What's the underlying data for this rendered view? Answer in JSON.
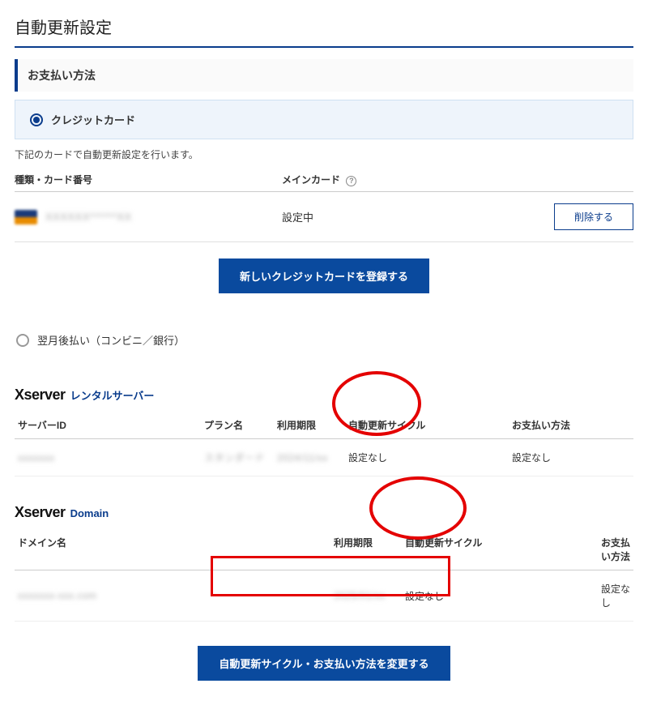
{
  "page": {
    "title": "自動更新設定"
  },
  "payment": {
    "section_title": "お支払い方法",
    "credit_card_label": "クレジットカード",
    "description": "下記のカードで自動更新設定を行います。",
    "col_type": "種類・カード番号",
    "col_main": "メインカード",
    "row": {
      "number_masked": "XXXXXX******XX",
      "main_status": "設定中"
    },
    "delete_label": "削除する",
    "register_button": "新しいクレジットカードを登録する",
    "later_label": "翌月後払い（コンビニ／銀行）"
  },
  "server": {
    "brand": "Xserver",
    "sub": "レンタルサーバー",
    "cols": {
      "id": "サーバーID",
      "plan": "プラン名",
      "period": "利用期限",
      "cycle": "自動更新サイクル",
      "pay": "お支払い方法"
    },
    "row": {
      "id": "xxxxxxx",
      "plan": "スタンダード",
      "period": "2024/11/xx",
      "cycle": "設定なし",
      "pay": "設定なし"
    }
  },
  "domain": {
    "brand": "Xserver",
    "sub": "Domain",
    "cols": {
      "name": "ドメイン名",
      "period": "利用期限",
      "cycle": "自動更新サイクル",
      "pay": "お支払い方法"
    },
    "row": {
      "name": "xxxxxxx-xxx.com",
      "period": "2025/01/xx",
      "cycle": "設定なし",
      "pay": "設定なし"
    }
  },
  "change_button": "自動更新サイクル・お支払い方法を変更する"
}
